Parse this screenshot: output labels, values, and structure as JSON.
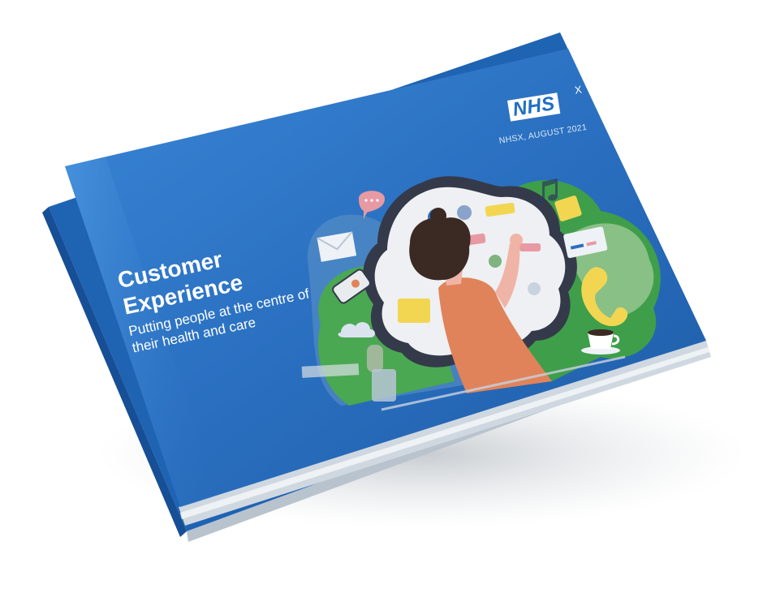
{
  "cover": {
    "logo_text": "NHS",
    "logo_superscript": "X",
    "date_line": "NHSX, AUGUST 2021",
    "title_line_1": "Customer",
    "title_line_2": "Experience",
    "subtitle": "Putting people at the centre of their health and care"
  },
  "colors": {
    "cover_blue": "#2a6fc0",
    "cover_blue_dark": "#1d5aa4",
    "page_edge": "#c9d4de",
    "illustration_green": "#3f9e4a",
    "illustration_orange": "#e0835a",
    "illustration_yellow": "#f2d652",
    "nhs_logo_blue": "#1f6fc2"
  },
  "icons": [
    "envelope-icon",
    "chat-bubble-icon",
    "phone-handset-icon",
    "mobile-phone-icon",
    "coffee-cup-icon",
    "cloud-icon",
    "credit-card-icon",
    "music-note-icon",
    "play-button-icon"
  ]
}
